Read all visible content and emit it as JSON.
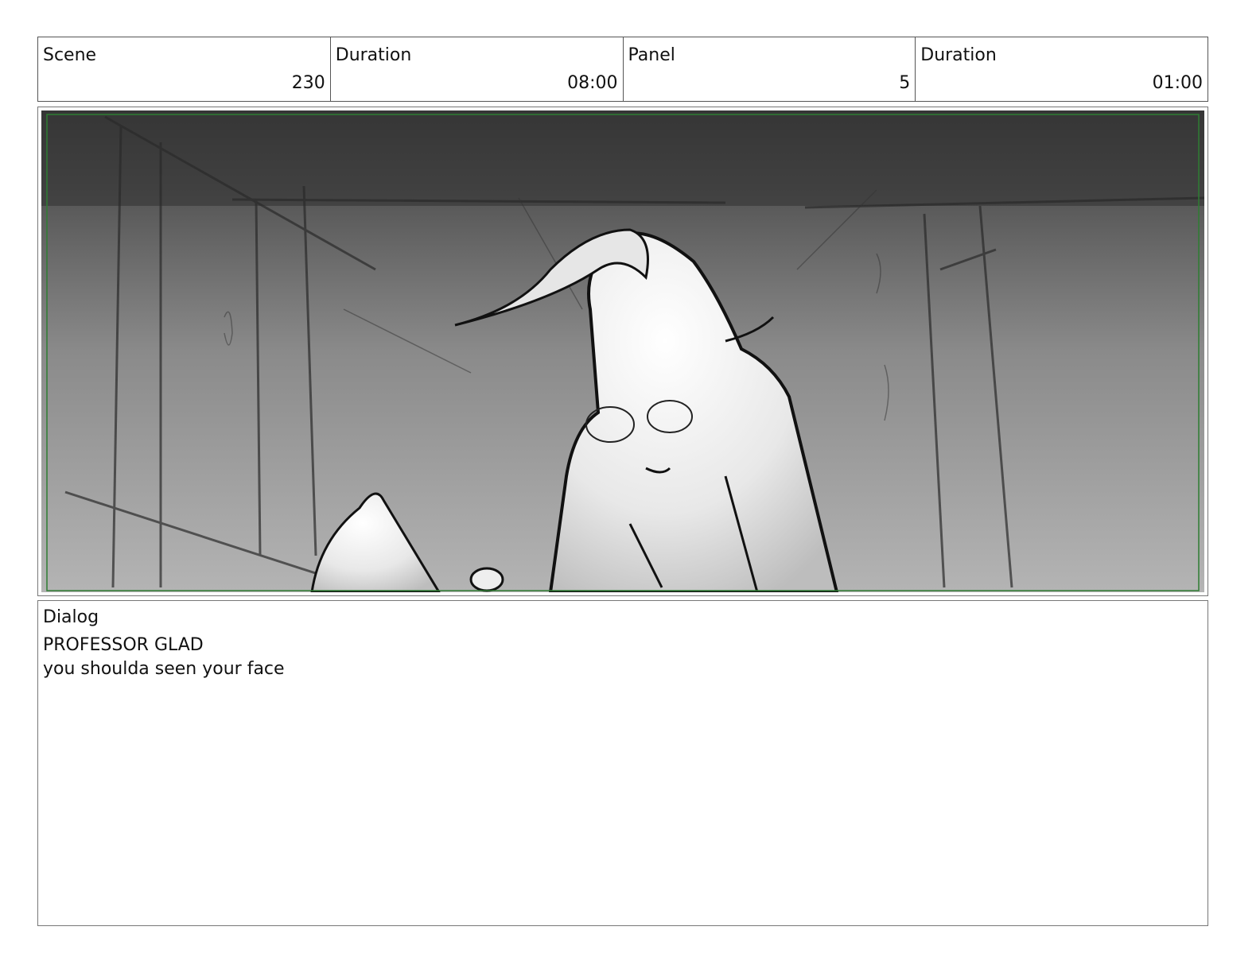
{
  "header": {
    "scene_label": "Scene",
    "scene_value": "230",
    "scene_duration_label": "Duration",
    "scene_duration_value": "08:00",
    "panel_label": "Panel",
    "panel_value": "5",
    "panel_duration_label": "Duration",
    "panel_duration_value": "01:00"
  },
  "dialog": {
    "label": "Dialog",
    "speaker": "PROFESSOR GLAD",
    "line": "you shoulda seen your face"
  },
  "colors": {
    "frame_border": "#777777",
    "safe_area": "#2e7d32"
  }
}
